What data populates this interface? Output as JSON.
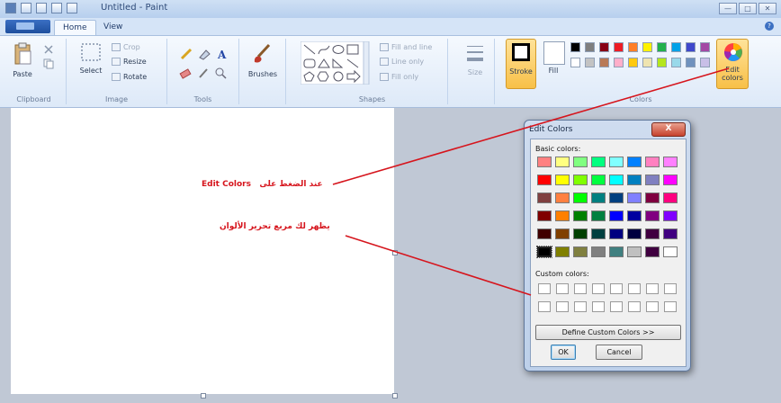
{
  "window": {
    "title": "Untitled - Paint",
    "minimize": "—",
    "restore": "□",
    "close": "✕"
  },
  "tabs": [
    {
      "label": "Home"
    },
    {
      "label": "View"
    }
  ],
  "help_icon": "?",
  "ribbon": {
    "clipboard": {
      "group_label": "Clipboard",
      "paste": "Paste"
    },
    "image": {
      "group_label": "Image",
      "select": "Select",
      "crop": "Crop",
      "resize": "Resize",
      "rotate": "Rotate"
    },
    "tools": {
      "group_label": "Tools"
    },
    "brushes": {
      "label": "Brushes"
    },
    "shapes": {
      "group_label": "Shapes",
      "fill_and_line": "Fill and line",
      "line_only": "Line only",
      "fill_only": "Fill only"
    },
    "size": {
      "label": "Size"
    },
    "colors": {
      "group_label": "Colors",
      "stroke": "Stroke",
      "fill": "Fill",
      "edit_colors": "Edit colors",
      "palette_row1": [
        "#000000",
        "#7f7f7f",
        "#880015",
        "#ed1c24",
        "#ff7f27",
        "#fff200",
        "#22b14c",
        "#00a2e8",
        "#3f48cc",
        "#a349a4"
      ],
      "palette_row2": [
        "#ffffff",
        "#c3c3c3",
        "#b97a57",
        "#ffaec9",
        "#ffc90e",
        "#efe4b0",
        "#b5e61d",
        "#99d9ea",
        "#7092be",
        "#c8bfe7"
      ],
      "stroke_color": "#000000",
      "fill_color": "#ffffff"
    }
  },
  "annotations": {
    "edit_colors_note_ar": "عند الضغط على",
    "edit_colors_note_en": "Edit Colors",
    "dialog_note": "يظهر لك مربع تحرير الألوان"
  },
  "dialog": {
    "title": "Edit Colors",
    "close_label": "X",
    "basic_colors_label": "Basic colors:",
    "custom_colors_label": "Custom colors:",
    "define_custom_button": "Define Custom Colors >>",
    "ok_button": "OK",
    "cancel_button": "Cancel",
    "basic_colors": [
      [
        "#ff8080",
        "#ffff80",
        "#80ff80",
        "#00ff80",
        "#80ffff",
        "#0080ff",
        "#ff80c0",
        "#ff80ff"
      ],
      [
        "#ff0000",
        "#ffff00",
        "#80ff00",
        "#00ff40",
        "#00ffff",
        "#0080c0",
        "#8080c0",
        "#ff00ff"
      ],
      [
        "#804040",
        "#ff8040",
        "#00ff00",
        "#008080",
        "#004080",
        "#8080ff",
        "#800040",
        "#ff0080"
      ],
      [
        "#800000",
        "#ff8000",
        "#008000",
        "#008040",
        "#0000ff",
        "#0000a0",
        "#800080",
        "#8000ff"
      ],
      [
        "#400000",
        "#804000",
        "#004000",
        "#004040",
        "#000080",
        "#000040",
        "#400040",
        "#400080"
      ],
      [
        "#000000",
        "#808000",
        "#808040",
        "#808080",
        "#408080",
        "#c0c0c0",
        "#400040",
        "#ffffff"
      ]
    ],
    "custom_color_count": 16
  }
}
